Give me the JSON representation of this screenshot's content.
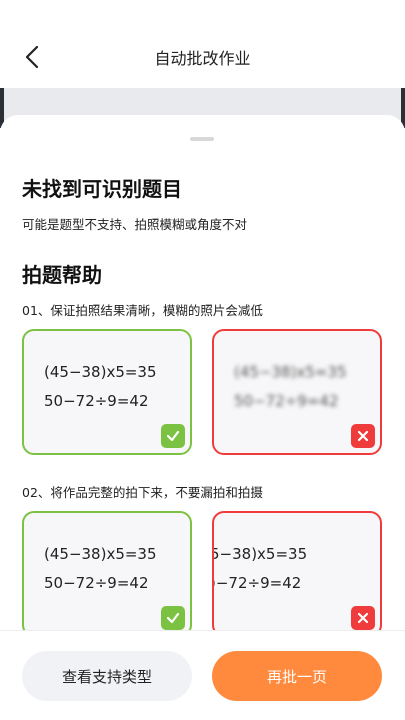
{
  "header": {
    "title": "自动批改作业",
    "back_icon": "chevron-left-icon"
  },
  "sheet": {
    "title": "未找到可识别题目",
    "subtitle": "可能是题型不支持、拍照模糊或角度不对",
    "help_title": "拍题帮助",
    "tips": [
      {
        "text": "01、保证拍照结果清晰，模糊的照片会减低",
        "good": {
          "line1": "(45−38)x5=35",
          "line2": "50−72÷9=42",
          "badge_icon": "check-icon"
        },
        "bad": {
          "line1": "(45−38)x5=35",
          "line2": "50−72÷9=42",
          "badge_icon": "close-icon"
        }
      },
      {
        "text": "02、将作品完整的拍下来，不要漏拍和拍摄",
        "good": {
          "line1": "(45−38)x5=35",
          "line2": "50−72÷9=42",
          "badge_icon": "check-icon"
        },
        "bad": {
          "line1": "5−38)x5=35",
          "line2": ")−72÷9=42",
          "badge_icon": "close-icon"
        }
      }
    ]
  },
  "footer": {
    "supported_types_label": "查看支持类型",
    "retry_label": "再批一页"
  },
  "colors": {
    "good": "#7cc242",
    "bad": "#ef3b3b",
    "accent": "#ff8a3d"
  }
}
